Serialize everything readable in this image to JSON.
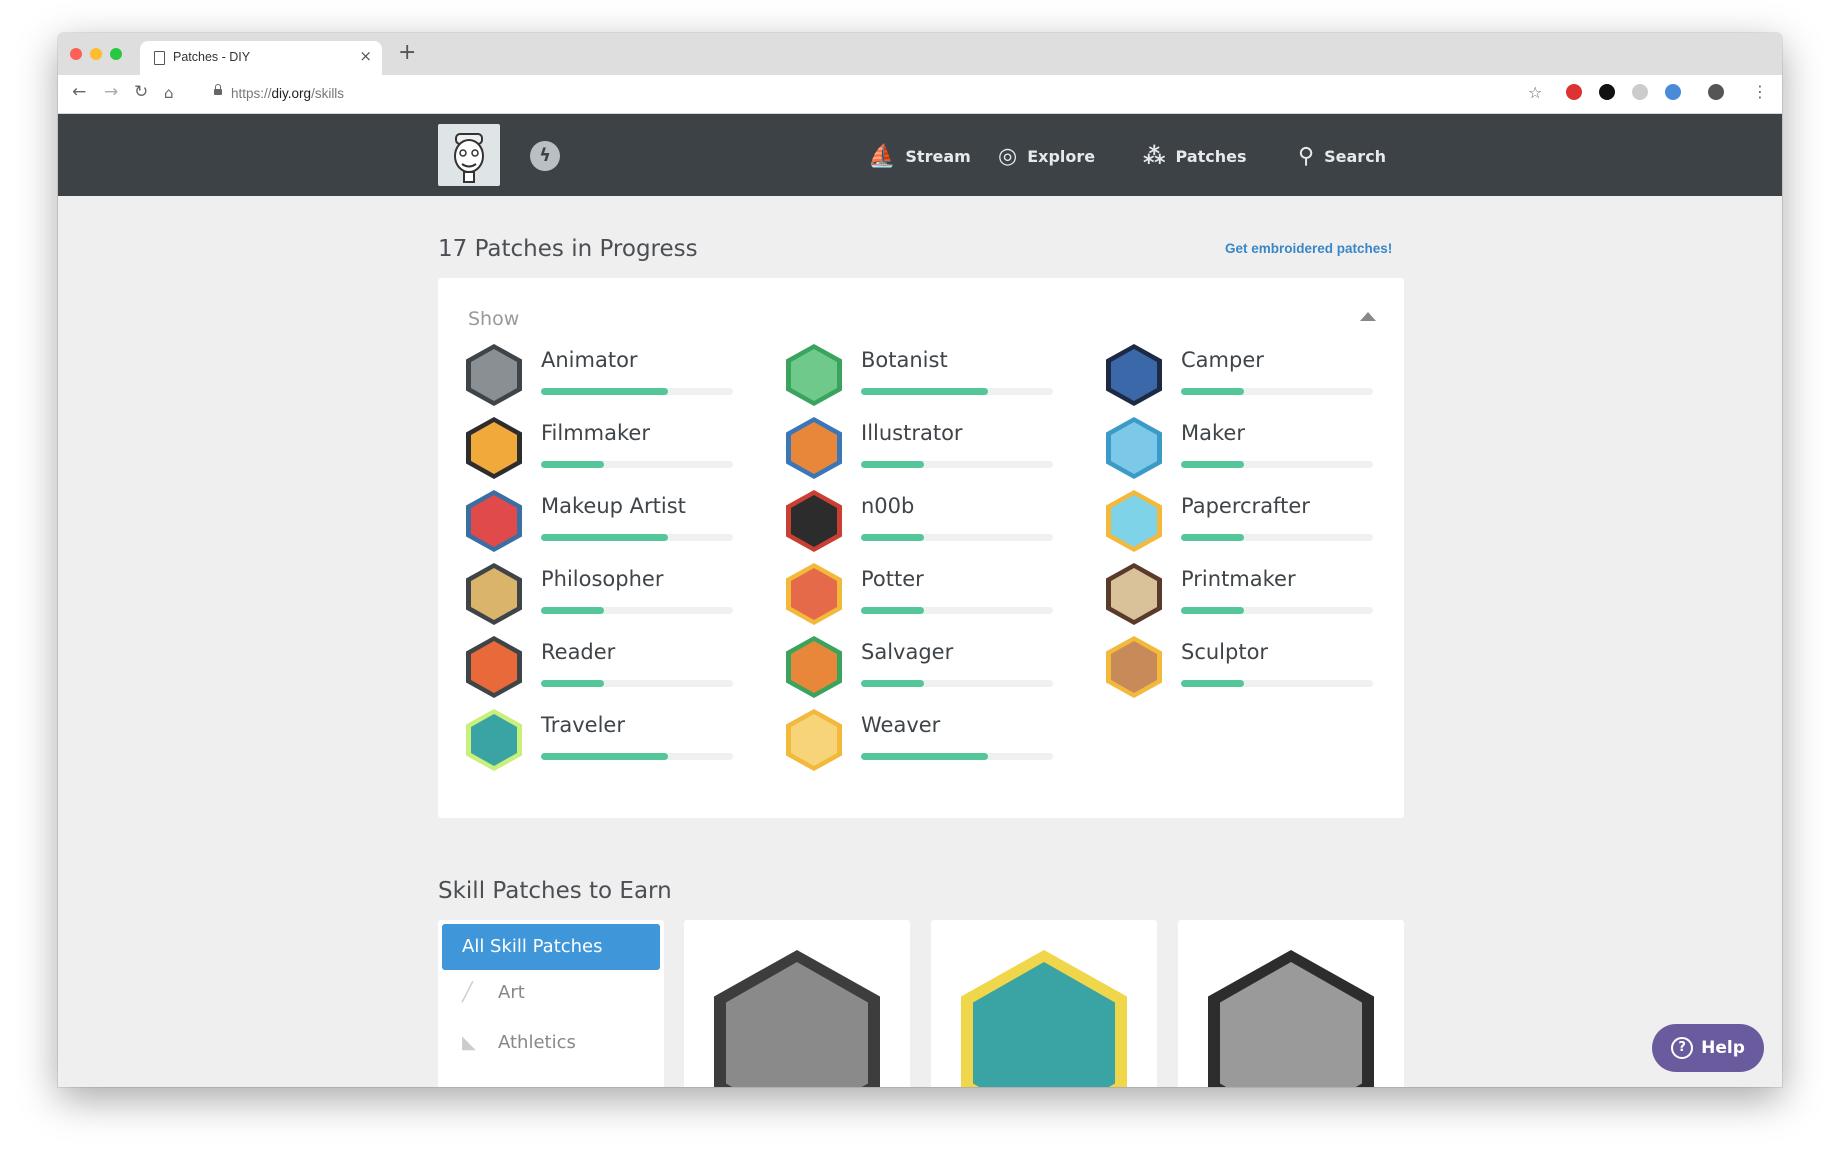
{
  "browser": {
    "tab_title": "Patches - DIY",
    "url_prefix": "https://",
    "url_host": "diy.org",
    "url_path": "/skills"
  },
  "header": {
    "nav": [
      {
        "label": "Stream",
        "icon": "boat-icon"
      },
      {
        "label": "Explore",
        "icon": "planet-icon"
      },
      {
        "label": "Patches",
        "icon": "patches-icon"
      },
      {
        "label": "Search",
        "icon": "search-icon"
      }
    ]
  },
  "progress": {
    "title": "17 Patches in Progress",
    "link": "Get embroidered patches!",
    "show_label": "Show",
    "patches": [
      {
        "name": "Animator",
        "progress": 0.66,
        "color": "#3f4448",
        "inner": "#8a8f93"
      },
      {
        "name": "Botanist",
        "progress": 0.66,
        "color": "#3aa35d",
        "inner": "#6ec98a"
      },
      {
        "name": "Camper",
        "progress": 0.33,
        "color": "#1d2a44",
        "inner": "#3b68a8"
      },
      {
        "name": "Filmmaker",
        "progress": 0.33,
        "color": "#2d2d2d",
        "inner": "#f2a93b"
      },
      {
        "name": "Illustrator",
        "progress": 0.33,
        "color": "#3a76b8",
        "inner": "#e8873a"
      },
      {
        "name": "Maker",
        "progress": 0.33,
        "color": "#3a9bc9",
        "inner": "#7cc8e8"
      },
      {
        "name": "Makeup Artist",
        "progress": 0.66,
        "color": "#3b6fa3",
        "inner": "#e04a4a"
      },
      {
        "name": "n00b",
        "progress": 0.33,
        "color": "#c94032",
        "inner": "#2c2c2c"
      },
      {
        "name": "Papercrafter",
        "progress": 0.33,
        "color": "#f2b93b",
        "inner": "#7fd3e8"
      },
      {
        "name": "Philosopher",
        "progress": 0.33,
        "color": "#3f4448",
        "inner": "#d9b46a"
      },
      {
        "name": "Potter",
        "progress": 0.33,
        "color": "#f2b93b",
        "inner": "#e46a4a"
      },
      {
        "name": "Printmaker",
        "progress": 0.33,
        "color": "#5a3a2a",
        "inner": "#d9c29a"
      },
      {
        "name": "Reader",
        "progress": 0.33,
        "color": "#3f4448",
        "inner": "#e86a3a"
      },
      {
        "name": "Salvager",
        "progress": 0.33,
        "color": "#3aa35d",
        "inner": "#e8873a"
      },
      {
        "name": "Sculptor",
        "progress": 0.33,
        "color": "#f2b93b",
        "inner": "#c98a5a"
      },
      {
        "name": "Traveler",
        "progress": 0.66,
        "color": "#c9f07a",
        "inner": "#3aa3a3"
      },
      {
        "name": "Weaver",
        "progress": 0.66,
        "color": "#f2b93b",
        "inner": "#f7d37a"
      }
    ]
  },
  "earn": {
    "title": "Skill Patches to Earn",
    "filters": [
      {
        "label": "All Skill Patches",
        "active": true
      },
      {
        "label": "Art",
        "icon": "brush-icon"
      },
      {
        "label": "Athletics",
        "icon": "shoe-icon"
      }
    ],
    "cards": [
      {
        "icon": "statue-patch-icon",
        "outer": "#3d3d3d",
        "inner": "#8a8a8a"
      },
      {
        "icon": "fish-patch-icon",
        "outer": "#f0d64a",
        "inner": "#3aa3a3"
      },
      {
        "icon": "runners-patch-icon",
        "outer": "#2d2d2d",
        "inner": "#9a9a9a"
      }
    ]
  },
  "help": {
    "label": "Help"
  }
}
